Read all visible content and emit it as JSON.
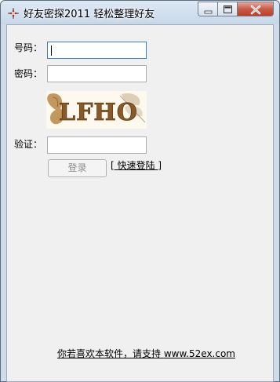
{
  "window": {
    "title": "好友密探2011 轻松整理好友",
    "controls": {
      "minimize": "minimize",
      "maximize": "maximize",
      "close": "close"
    }
  },
  "form": {
    "account_label": "号码：",
    "account_value": "",
    "password_label": "密码：",
    "password_value": "",
    "captcha_text": "LFHO",
    "verify_label": "验证：",
    "verify_value": "",
    "login_button": "登录",
    "quick_login_open": "[",
    "quick_login_text": "快速登陆",
    "quick_login_close": "]"
  },
  "footer": {
    "support_text": "你若喜欢本软件，请支持",
    "support_url": "www.52ex.com"
  },
  "colors": {
    "captcha_ink": "#8a5a26",
    "titlebar": "#cfdbe8",
    "client_bg": "#f0f0f0"
  }
}
